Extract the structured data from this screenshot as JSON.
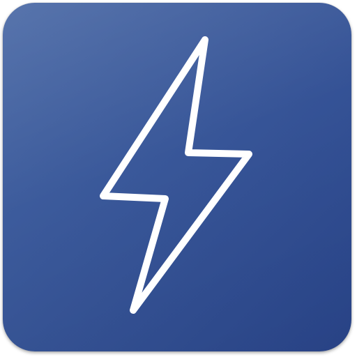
{
  "app_icon": {
    "icon": "lightning-bolt-icon",
    "background_color_start": "#2a468d",
    "background_color_end": "#4565a3",
    "symbol_color": "#ffffff"
  }
}
